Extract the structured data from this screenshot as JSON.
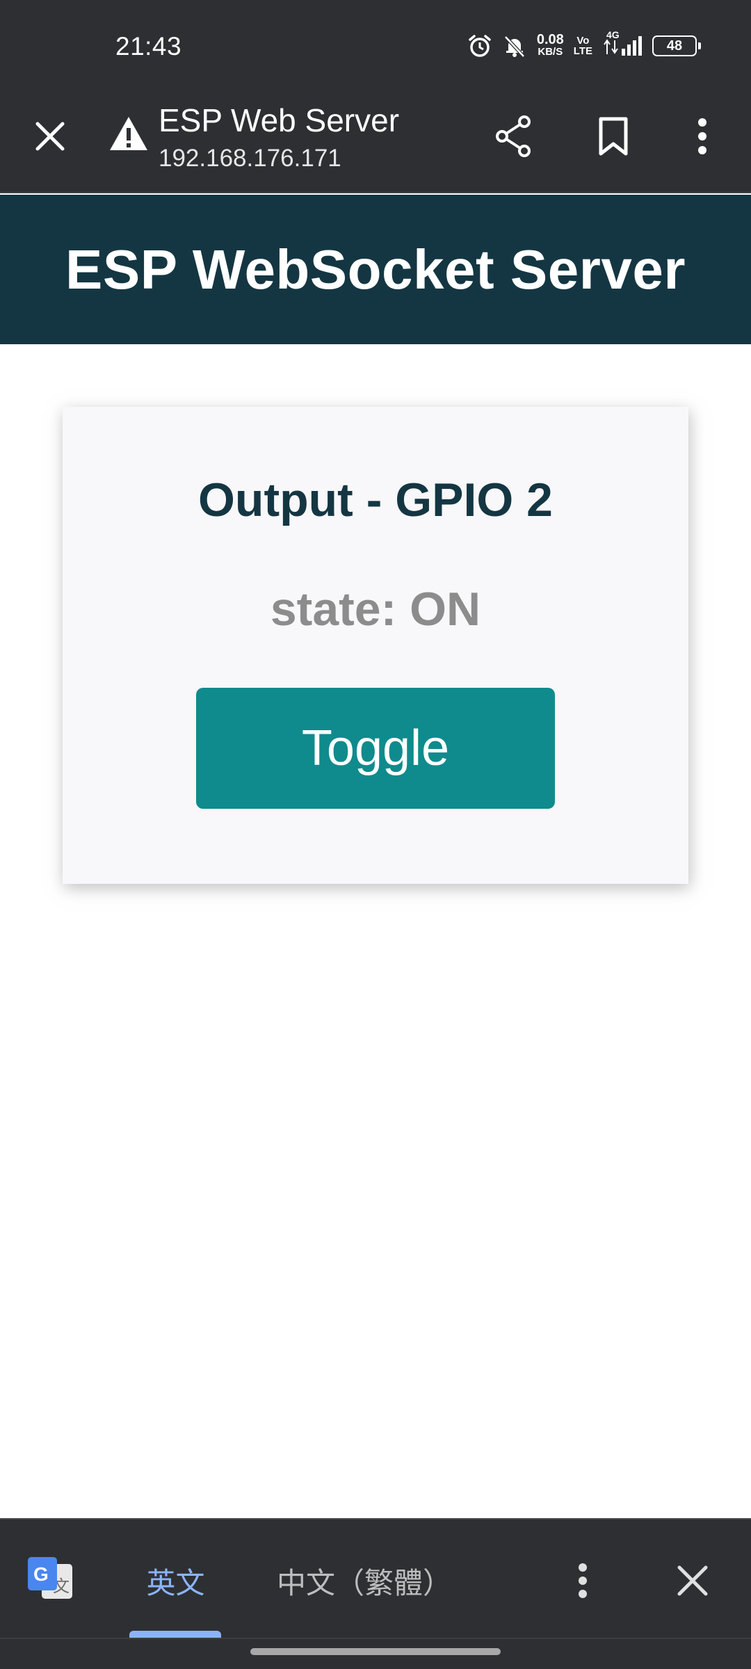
{
  "status_bar": {
    "time": "21:43",
    "net_speed_value": "0.08",
    "net_speed_unit": "KB/S",
    "volte_top": "Vo",
    "volte_bottom": "LTE",
    "network_type": "4G",
    "battery_level": "48",
    "icons": [
      "alarm-icon",
      "notifications-off-icon",
      "signal-icon",
      "battery-icon"
    ]
  },
  "browser": {
    "page_title": "ESP Web Server",
    "url": "192.168.176.171",
    "icons": [
      "close-icon",
      "warning-icon",
      "share-icon",
      "bookmark-icon",
      "more-vert-icon"
    ]
  },
  "page": {
    "header_title": "ESP WebSocket Server",
    "card_title": "Output - GPIO 2",
    "state_text": "state: ON",
    "toggle_label": "Toggle"
  },
  "translate_bar": {
    "source_lang": "英文",
    "target_lang": "中文（繁體）",
    "icons": [
      "google-translate-icon",
      "more-vert-icon",
      "close-icon"
    ]
  },
  "colors": {
    "system_bar": "#2e2f33",
    "header_bg": "#143642",
    "card_bg": "#f8f7f9",
    "button_bg": "#0f8b8d",
    "state_gray": "#8c8c8c",
    "translate_accent": "#8ab4f8"
  }
}
